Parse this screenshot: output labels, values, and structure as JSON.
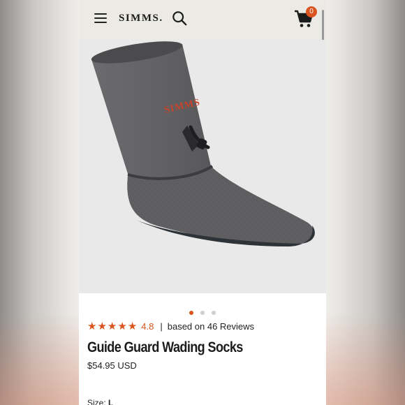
{
  "header": {
    "brand": "SIMMS.",
    "cart_count": "0"
  },
  "product": {
    "sock_logo": "SIMMS",
    "rating": "4.8",
    "separator": "|",
    "reviews": "based on 46 Reviews",
    "stars": 5,
    "title": "Guide Guard Wading Socks",
    "price": "$54.95 USD",
    "size_label": "Size:",
    "size_value": "L"
  },
  "carousel": {
    "count": 3,
    "active_index": 0
  },
  "colors": {
    "accent": "#d9541e",
    "header_bg": "#ebeae5",
    "sock": "#5e5e61"
  },
  "icons": [
    "menu-icon",
    "search-icon",
    "cart-icon",
    "star-icon"
  ]
}
